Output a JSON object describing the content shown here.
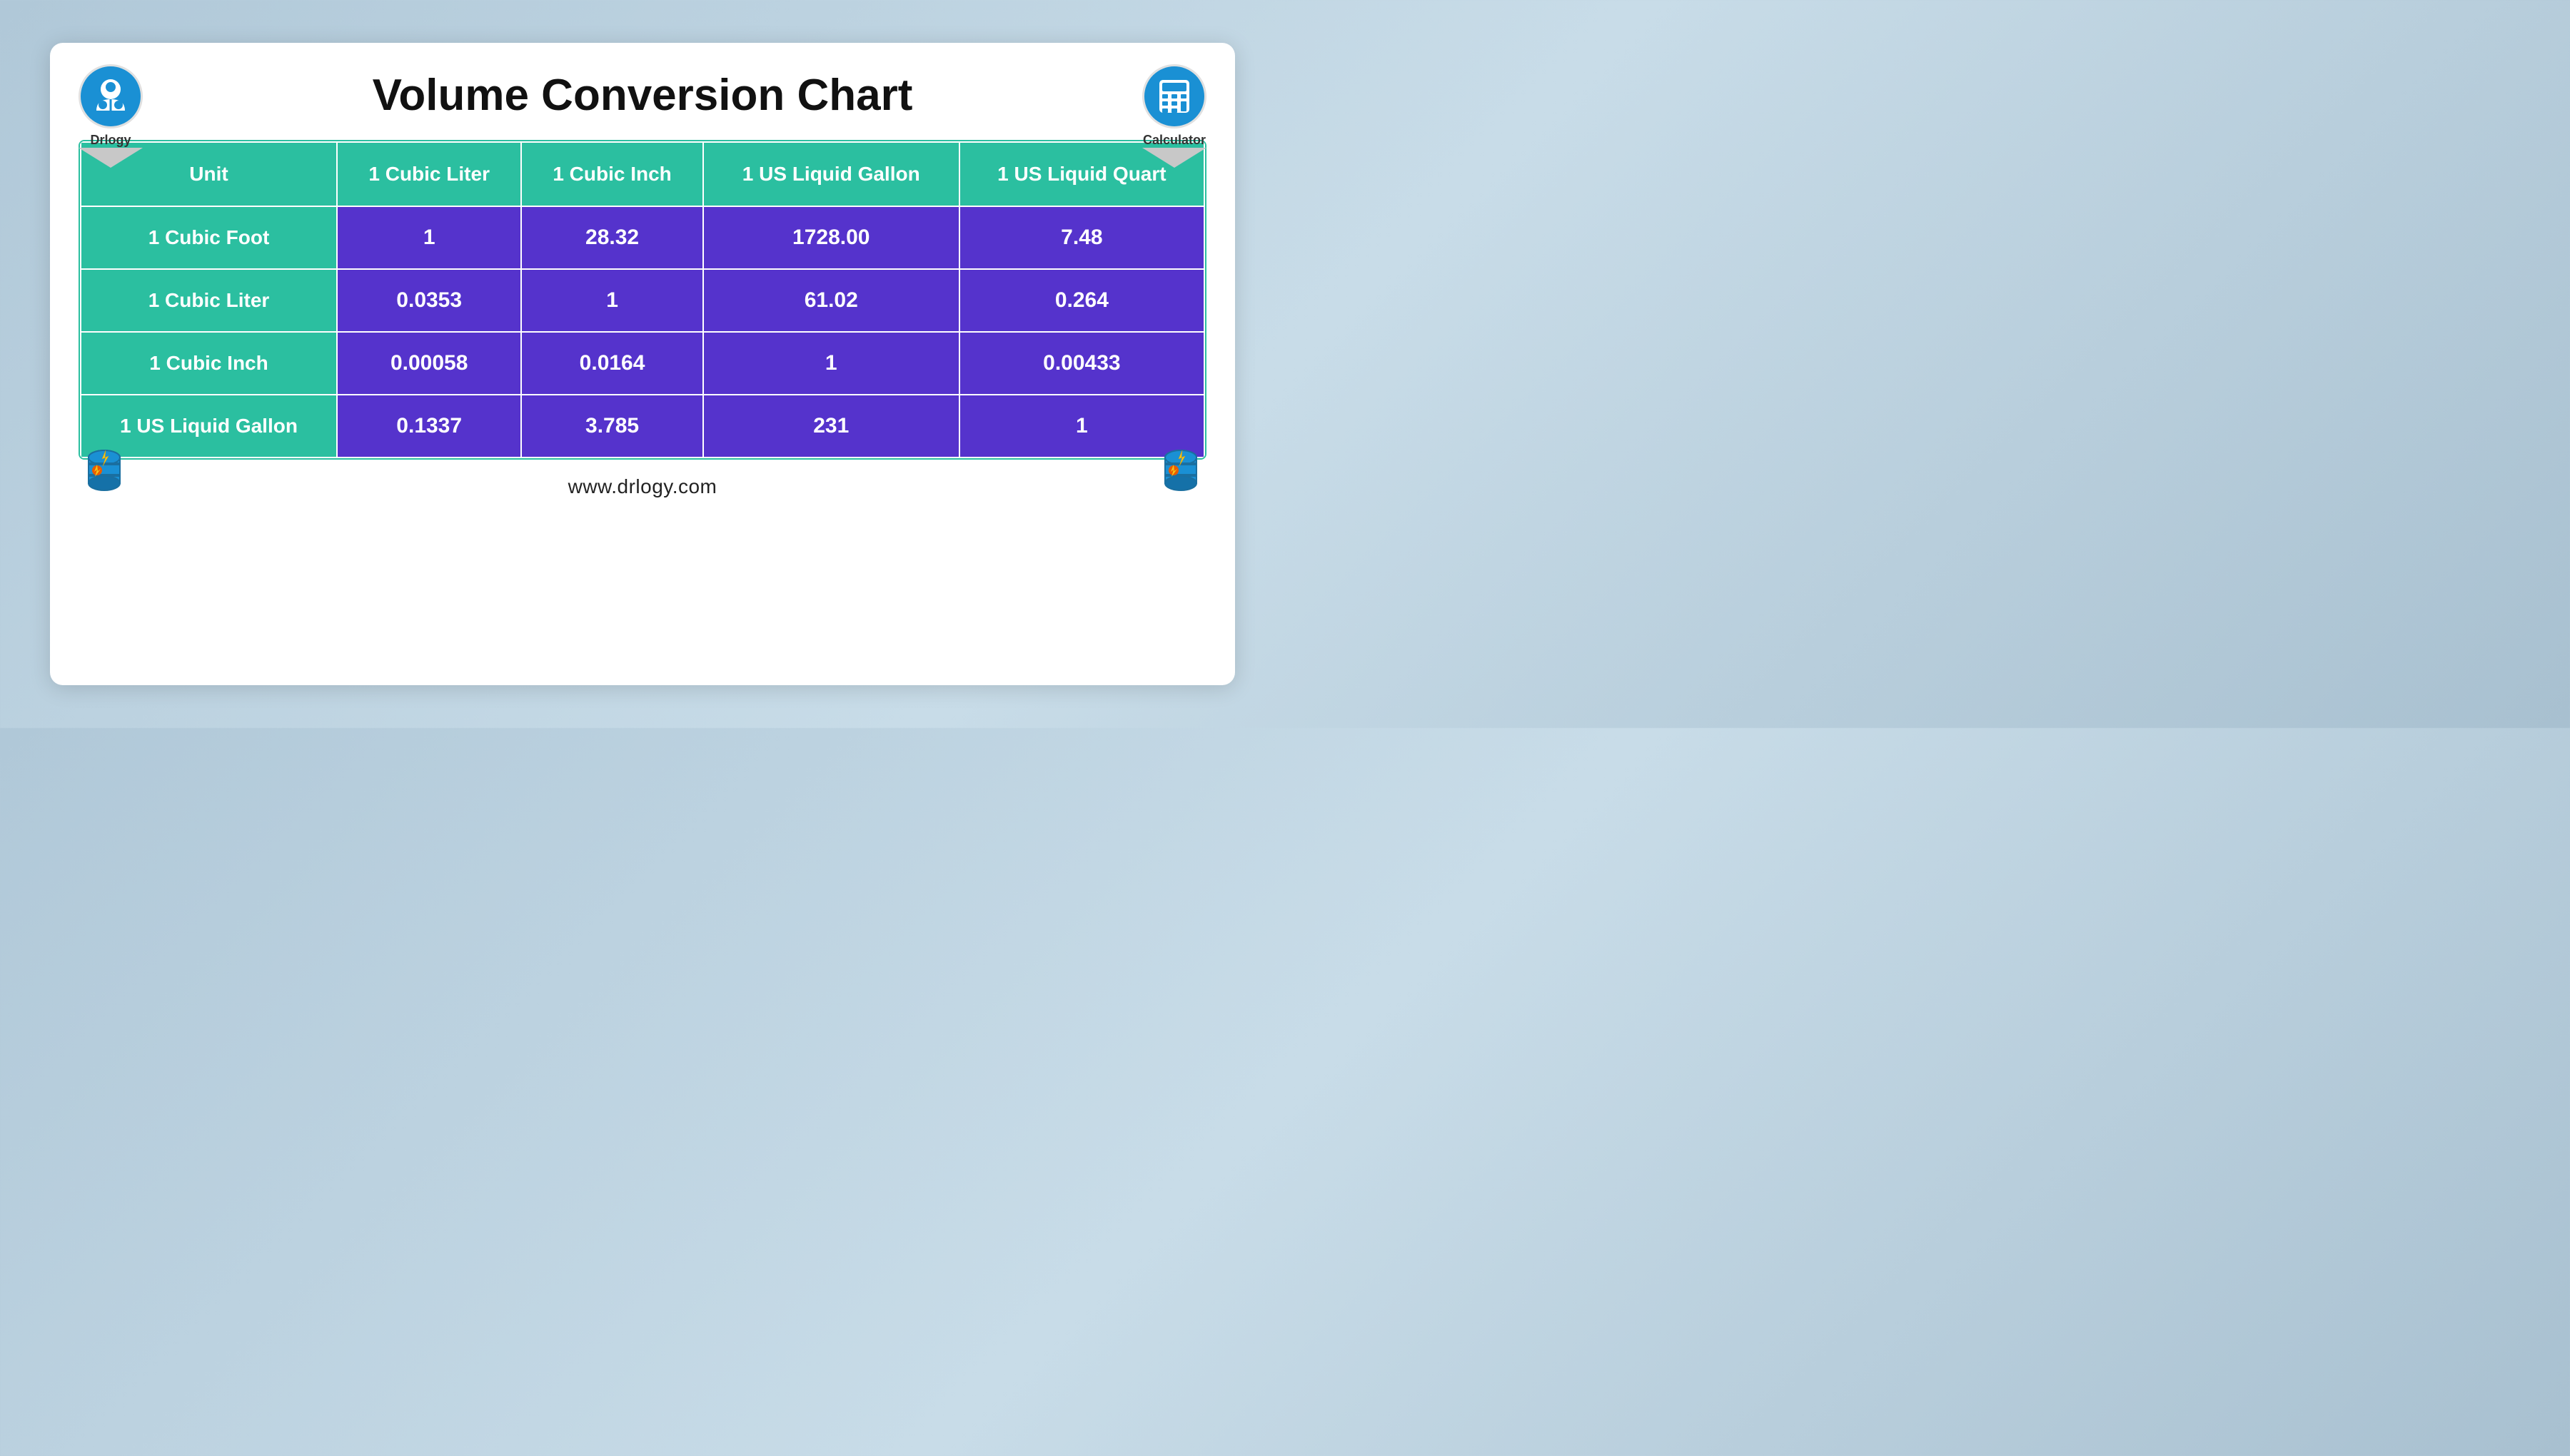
{
  "header": {
    "title": "Volume Conversion Chart",
    "logo_label": "Drlogy",
    "calc_label": "Calculator"
  },
  "table": {
    "columns": [
      "Unit",
      "1 Cubic Liter",
      "1 Cubic Inch",
      "1 US Liquid Gallon",
      "1 US Liquid Quart"
    ],
    "rows": [
      [
        "1 Cubic Foot",
        "1",
        "28.32",
        "1728.00",
        "7.48"
      ],
      [
        "1 Cubic Liter",
        "0.0353",
        "1",
        "61.02",
        "0.264"
      ],
      [
        "1 Cubic Inch",
        "0.00058",
        "0.0164",
        "1",
        "0.00433"
      ],
      [
        "1 US Liquid Gallon",
        "0.1337",
        "3.785",
        "231",
        "1"
      ]
    ]
  },
  "footer": {
    "url": "www.drlogy.com"
  },
  "colors": {
    "teal": "#2bbfa0",
    "purple": "#5533cc",
    "blue": "#1a90d4"
  }
}
